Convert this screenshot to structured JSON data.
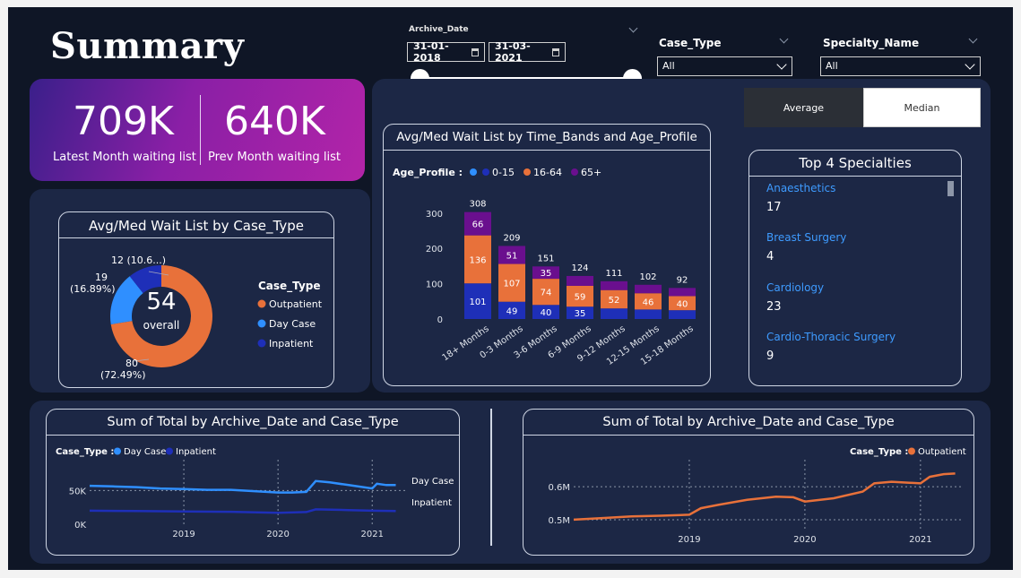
{
  "page_title": "Summary",
  "archive_date": {
    "label": "Archive_Date",
    "start": "31-01-2018",
    "end": "31-03-2021"
  },
  "case_type_filter": {
    "label": "Case_Type",
    "value": "All"
  },
  "specialty_filter": {
    "label": "Specialty_Name",
    "value": "All"
  },
  "kpis": [
    {
      "value": "709K",
      "label": "Latest Month waiting list"
    },
    {
      "value": "640K",
      "label": "Prev Month waiting list"
    }
  ],
  "toggle": {
    "average": "Average",
    "median": "Median",
    "selected": "median"
  },
  "donut": {
    "title": "Avg/Med Wait List by Case_Type",
    "center_value": "54",
    "center_label": "overall",
    "legend_title": "Case_Type",
    "slices": [
      {
        "name": "Outpatient",
        "value": 80,
        "label_a": "80",
        "label_b": "(72.49%)",
        "pct": 72.49,
        "color": "#e8713a"
      },
      {
        "name": "Day Case",
        "value": 19,
        "label_a": "19",
        "label_b": "(16.89%)",
        "pct": 16.89,
        "color": "#2f8fff"
      },
      {
        "name": "Inpatient",
        "value": 12,
        "label_a": "12 (10.6...)",
        "label_b": "",
        "pct": 10.62,
        "color": "#1e2fb8"
      }
    ]
  },
  "stacked": {
    "title": "Avg/Med Wait List by Time_Bands and Age_Profile",
    "legend_title": "Age_Profile :",
    "legend": [
      {
        "name": "",
        "color": "#2f8fff"
      },
      {
        "name": "0-15",
        "color": "#1e2fb8"
      },
      {
        "name": "16-64",
        "color": "#e8713a"
      },
      {
        "name": "65+",
        "color": "#6a0f8e"
      }
    ],
    "y_ticks": [
      "0",
      "100",
      "200",
      "300"
    ]
  },
  "chart_data": [
    {
      "type": "bar",
      "stacked": true,
      "title": "Avg/Med Wait List by Time_Bands and Age_Profile",
      "categories": [
        "18+ Months",
        "0-3 Months",
        "3-6 Months",
        "6-9 Months",
        "9-12 Months",
        "12-15 Months",
        "15-18 Months"
      ],
      "totals": [
        308,
        209,
        151,
        124,
        111,
        102,
        92
      ],
      "series": [
        {
          "name": "0-15",
          "values": [
            101,
            49,
            40,
            35,
            30,
            27,
            25
          ],
          "labels": [
            "101",
            "49",
            "40",
            "35",
            "",
            "",
            ""
          ]
        },
        {
          "name": "16-64",
          "values": [
            136,
            107,
            74,
            59,
            52,
            46,
            40
          ],
          "labels": [
            "136",
            "107",
            "74",
            "59",
            "52",
            "46",
            "40"
          ]
        },
        {
          "name": "65+",
          "values": [
            66,
            51,
            35,
            28,
            25,
            24,
            23
          ],
          "labels": [
            "66",
            "51",
            "35",
            "",
            "",
            "",
            ""
          ]
        }
      ],
      "ylim": [
        0,
        330
      ]
    },
    {
      "type": "line",
      "title": "Sum of Total by Archive_Date and Case_Type",
      "legend_title": "Case_Type :",
      "x_ticks": [
        "2019",
        "2020",
        "2021"
      ],
      "y_ticks": [
        "0K",
        "50K"
      ],
      "series": [
        {
          "name": "Day Case",
          "color": "#2f8fff",
          "x": [
            2018.0,
            2018.25,
            2018.5,
            2018.75,
            2019.0,
            2019.25,
            2019.5,
            2019.75,
            2020.0,
            2020.15,
            2020.3,
            2020.4,
            2020.55,
            2020.75,
            2021.0,
            2021.05,
            2021.15,
            2021.25
          ],
          "y": [
            57000,
            56000,
            55000,
            53000,
            52000,
            51000,
            51000,
            49000,
            47000,
            47000,
            48000,
            64000,
            62000,
            58000,
            53000,
            60000,
            58000,
            58000
          ]
        },
        {
          "name": "Inpatient",
          "color": "#1e2fb8",
          "x": [
            2018.0,
            2018.5,
            2019.0,
            2019.5,
            2020.0,
            2020.3,
            2020.4,
            2020.75,
            2021.0,
            2021.25
          ],
          "y": [
            20000,
            19500,
            19000,
            18500,
            17000,
            18000,
            22000,
            21000,
            20000,
            19500
          ]
        }
      ],
      "ylim": [
        0,
        85000
      ]
    },
    {
      "type": "line",
      "title": "Sum of Total by Archive_Date and Case_Type",
      "legend_title": "Case_Type :",
      "x_ticks": [
        "2019",
        "2020",
        "2021"
      ],
      "y_ticks": [
        "0.5M",
        "0.6M"
      ],
      "series": [
        {
          "name": "Outpatient",
          "color": "#e8713a",
          "x": [
            2018.0,
            2018.25,
            2018.5,
            2018.75,
            2019.0,
            2019.1,
            2019.25,
            2019.5,
            2019.75,
            2019.9,
            2020.0,
            2020.25,
            2020.5,
            2020.6,
            2020.75,
            2021.0,
            2021.08,
            2021.2,
            2021.3
          ],
          "y": [
            0.5,
            0.505,
            0.51,
            0.512,
            0.515,
            0.535,
            0.545,
            0.56,
            0.57,
            0.568,
            0.555,
            0.565,
            0.585,
            0.61,
            0.615,
            0.61,
            0.63,
            0.638,
            0.64
          ]
        }
      ],
      "ylim": [
        0.47,
        0.66
      ]
    }
  ],
  "specialties": {
    "title": "Top 4 Specialties",
    "items": [
      {
        "name": "Anaesthetics",
        "value": "17"
      },
      {
        "name": "Breast Surgery",
        "value": "4"
      },
      {
        "name": "Cardiology",
        "value": "23"
      },
      {
        "name": "Cardio-Thoracic Surgery",
        "value": "9"
      }
    ]
  },
  "line_left": {
    "title": "Sum of Total by Archive_Date and Case_Type",
    "legend_title": "Case_Type :",
    "legend": [
      "Day Case",
      "Inpatient"
    ],
    "end_labels": [
      "Day Case",
      "Inpatient"
    ]
  },
  "line_right": {
    "title": "Sum of Total by Archive_Date and Case_Type",
    "legend_title": "Case_Type :",
    "legend": [
      "Outpatient"
    ]
  }
}
